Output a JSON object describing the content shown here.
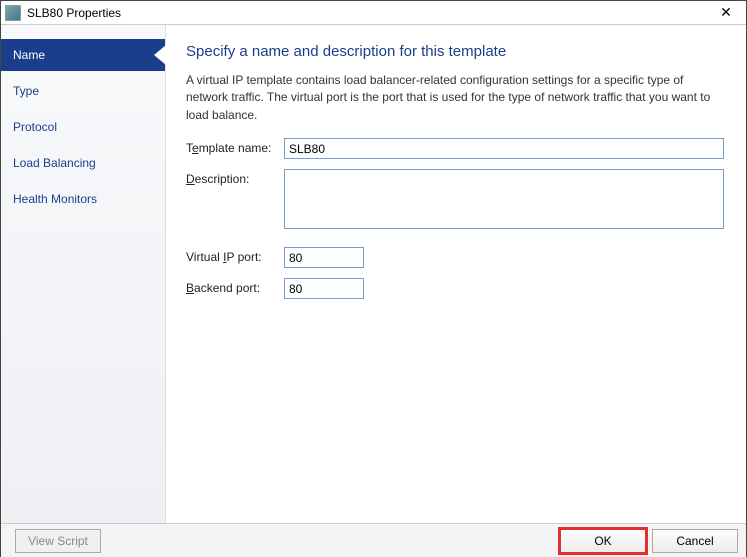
{
  "window": {
    "title": "SLB80 Properties"
  },
  "sidebar": {
    "items": [
      {
        "label": "Name",
        "selected": true
      },
      {
        "label": "Type",
        "selected": false
      },
      {
        "label": "Protocol",
        "selected": false
      },
      {
        "label": "Load Balancing",
        "selected": false
      },
      {
        "label": "Health Monitors",
        "selected": false
      }
    ]
  },
  "main": {
    "heading": "Specify a name and description for this template",
    "intro": "A virtual IP template contains load balancer-related configuration settings for a specific type of network traffic. The virtual port is the port that is used for the type of network traffic that you want to load balance.",
    "labels": {
      "template_name_pre": "T",
      "template_name_ul": "e",
      "template_name_post": "mplate name:",
      "description_pre": "",
      "description_ul": "D",
      "description_post": "escription:",
      "vip_pre": "Virtual ",
      "vip_ul": "I",
      "vip_post": "P port:",
      "backend_pre": "",
      "backend_ul": "B",
      "backend_post": "ackend port:"
    },
    "values": {
      "template_name": "SLB80",
      "description": "",
      "virtual_ip_port": "80",
      "backend_port": "80"
    }
  },
  "footer": {
    "view_script": "View Script",
    "ok": "OK",
    "cancel": "Cancel"
  }
}
